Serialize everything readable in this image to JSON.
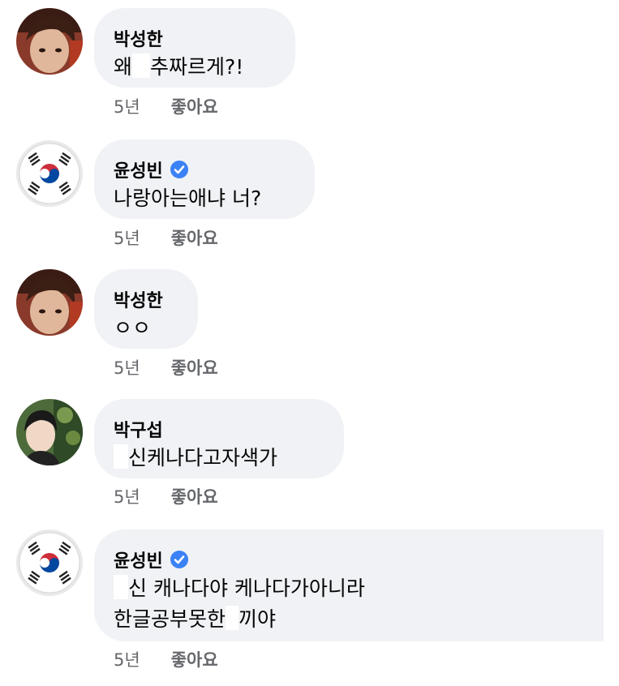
{
  "comments": [
    {
      "author": "박성한",
      "text_before": "왜",
      "text_after": "추짜르게?!",
      "time": "5년",
      "like": "좋아요",
      "verified": false,
      "avatar": "photo-boy"
    },
    {
      "author": "윤성빈",
      "text": "나랑아는애냐 너?",
      "time": "5년",
      "like": "좋아요",
      "verified": true,
      "avatar": "korea-flag"
    },
    {
      "author": "박성한",
      "text": "ㅇㅇ",
      "time": "5년",
      "like": "좋아요",
      "verified": false,
      "avatar": "photo-boy"
    },
    {
      "author": "박구섭",
      "text_after": "신케나다고자색가",
      "time": "5년",
      "like": "좋아요",
      "verified": false,
      "avatar": "photo-selfie"
    },
    {
      "author": "윤성빈",
      "line1_after": "신 캐나다야 케나다가아니라",
      "line2_before": "한글공부못한",
      "line2_after": "끼야",
      "time": "5년",
      "like": "좋아요",
      "verified": true,
      "avatar": "korea-flag"
    }
  ],
  "colors": {
    "bubble": "#f0f2f5",
    "meta": "#65676b",
    "verified": "#1877f2"
  }
}
